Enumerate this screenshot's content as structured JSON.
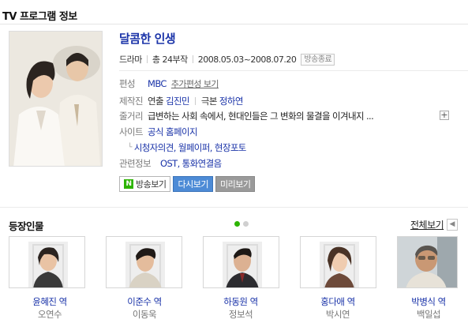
{
  "header": {
    "title": "TV 프로그램 정보"
  },
  "program": {
    "title": "달콤한 인생",
    "genre": "드라마",
    "episodes": "총 24부작",
    "period": "2008.05.03~2008.07.20",
    "status_badge": "방송종료",
    "channel_label": "편성",
    "channel": "MBC",
    "channel_extra": "추가편성 보기",
    "crew_label": "제작진",
    "director_role": "연출",
    "director": "김진민",
    "writer_role": "극본",
    "writer": "정하연",
    "plot_label": "줄거리",
    "plot": "급변하는 사회 속에서, 현대인들은 그 변화의 물결을 이겨내지 ...",
    "site_label": "사이트",
    "site_link": "공식 홈페이지",
    "site_sub_links": "시청자의견, 월페이퍼, 현장포토",
    "related_label": "관련정보",
    "related": "OST, 통화연결음"
  },
  "buttons": {
    "watch": "방송보기",
    "watch_icon_letter": "N",
    "replay": "다시보기",
    "preview": "미리보기"
  },
  "cast_section": {
    "title": "등장인물",
    "view_all": "전체보기",
    "members": [
      {
        "role": "윤혜진 역",
        "actor": "오연수"
      },
      {
        "role": "이준수 역",
        "actor": "이동욱"
      },
      {
        "role": "하동원 역",
        "actor": "정보석"
      },
      {
        "role": "홍다애 역",
        "actor": "박시연"
      },
      {
        "role": "박병식 역",
        "actor": "백일섭"
      }
    ]
  },
  "colors": {
    "link_blue": "#1a33a8",
    "naver_green": "#2db400",
    "replay_blue": "#4d8bd6"
  }
}
